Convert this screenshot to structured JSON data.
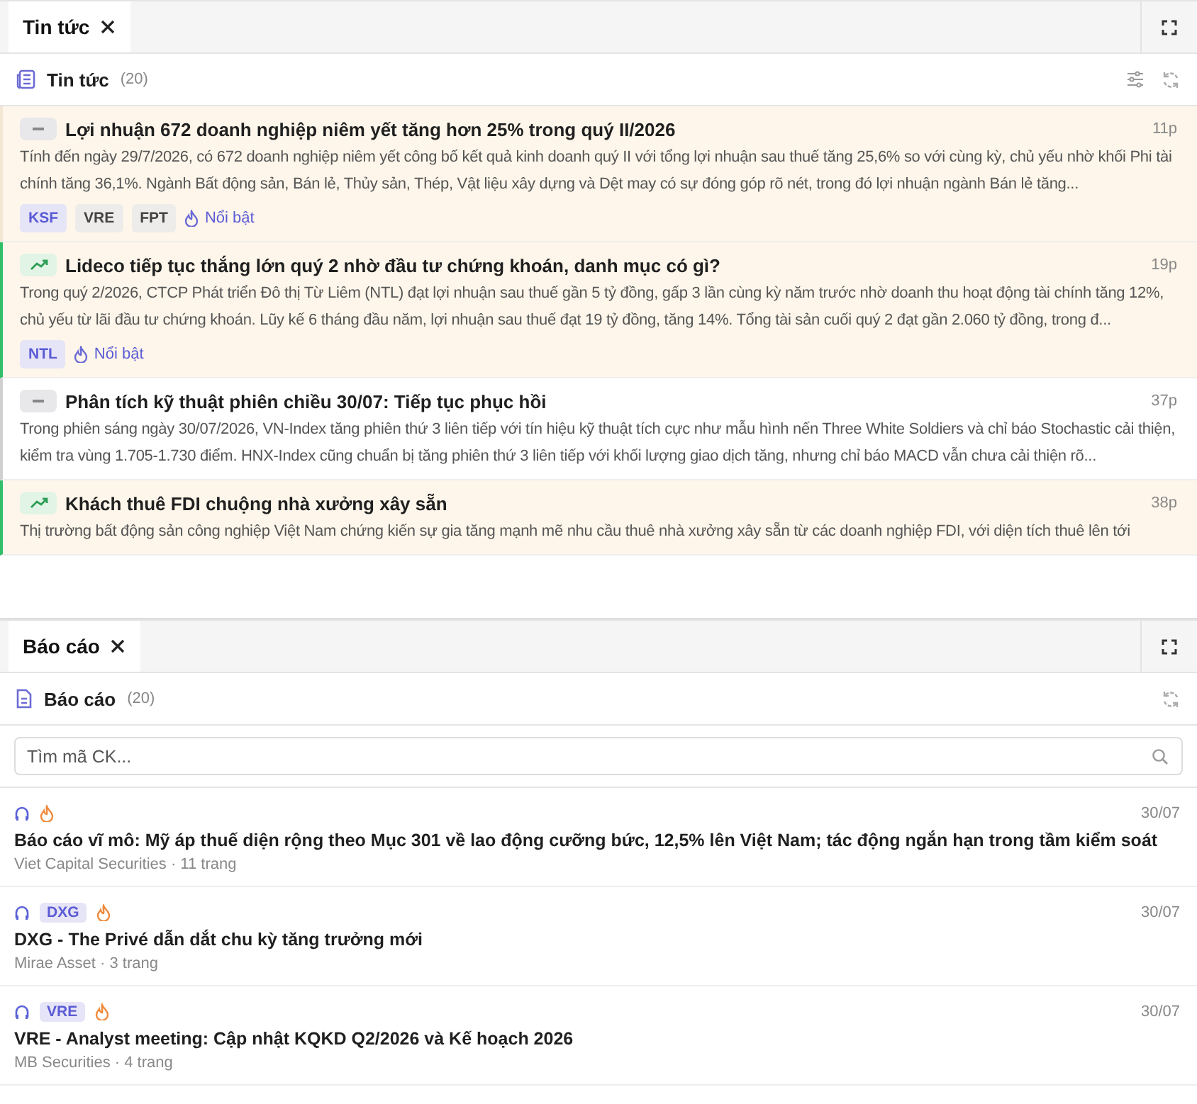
{
  "news_panel": {
    "tab": {
      "label": "Tin tức"
    },
    "header": {
      "title": "Tin tức",
      "count": "(20)"
    },
    "items": [
      {
        "kind": "neutral",
        "highlighted": true,
        "title": "Lợi nhuận 672 doanh nghiệp niêm yết tăng hơn 25% trong quý II/2026",
        "time": "11p",
        "summary": "Tính đến ngày 29/7/2026, có 672 doanh nghiệp niêm yết công bố kết quả kinh doanh quý II với tổng lợi nhuận sau thuế tăng 25,6% so với cùng kỳ, chủ yếu nhờ khối Phi tài chính tăng 36,1%. Ngành Bất động sản, Bán lẻ, Thủy sản, Thép, Vật liệu xây dựng và Dệt may có sự đóng góp rõ nét, trong đó lợi nhuận ngành Bán lẻ tăng...",
        "tags": [
          {
            "label": "KSF",
            "primary": true
          },
          {
            "label": "VRE",
            "primary": false
          },
          {
            "label": "FPT",
            "primary": false
          }
        ],
        "badge": "Nổi bật"
      },
      {
        "kind": "up",
        "highlighted": true,
        "title": "Lideco tiếp tục thắng lớn quý 2 nhờ đầu tư chứng khoán, danh mục có gì?",
        "time": "19p",
        "summary": "Trong quý 2/2026, CTCP Phát triển Đô thị Từ Liêm (NTL) đạt lợi nhuận sau thuế gần 5 tỷ đồng, gấp 3 lần cùng kỳ năm trước nhờ doanh thu hoạt động tài chính tăng 12%, chủ yếu từ lãi đầu tư chứng khoán. Lũy kế 6 tháng đầu năm, lợi nhuận sau thuế đạt 19 tỷ đồng, tăng 14%. Tổng tài sản cuối quý 2 đạt gần 2.060 tỷ đồng, trong đ...",
        "tags": [
          {
            "label": "NTL",
            "primary": true
          }
        ],
        "badge": "Nổi bật"
      },
      {
        "kind": "neutral",
        "highlighted": false,
        "title": "Phân tích kỹ thuật phiên chiều 30/07: Tiếp tục phục hồi",
        "time": "37p",
        "summary": "Trong phiên sáng ngày 30/07/2026, VN-Index tăng phiên thứ 3 liên tiếp với tín hiệu kỹ thuật tích cực như mẫu hình nến Three White Soldiers và chỉ báo Stochastic cải thiện, kiểm tra vùng 1.705-1.730 điểm. HNX-Index cũng chuẩn bị tăng phiên thứ 3 liên tiếp với khối lượng giao dịch tăng, nhưng chỉ báo MACD vẫn chưa cải thiện rõ..."
      },
      {
        "kind": "up",
        "highlighted": true,
        "title": "Khách thuê FDI chuộng nhà xưởng xây sẵn",
        "time": "38p",
        "summary": "Thị trường bất động sản công nghiệp Việt Nam chứng kiến sự gia tăng mạnh mẽ nhu cầu thuê nhà xưởng xây sẵn từ các doanh nghiệp FDI, với diện tích thuê lên tới"
      }
    ]
  },
  "reports_panel": {
    "tab": {
      "label": "Báo cáo"
    },
    "header": {
      "title": "Báo cáo",
      "count": "(20)"
    },
    "search": {
      "placeholder": "Tìm mã CK..."
    },
    "items": [
      {
        "hot": true,
        "date": "30/07",
        "title": "Báo cáo vĩ mô: Mỹ áp thuế diện rộng theo Mục 301 về lao động cưỡng bức, 12,5% lên Việt Nam; tác động ngắn hạn trong tầm kiểm soát",
        "meta": "Viet Capital Securities · 11 trang"
      },
      {
        "ticker": "DXG",
        "hot": true,
        "date": "30/07",
        "title": "DXG - The Privé dẫn dắt chu kỳ tăng trưởng mới",
        "meta": "Mirae Asset · 3 trang"
      },
      {
        "ticker": "VRE",
        "hot": true,
        "date": "30/07",
        "title": "VRE - Analyst meeting: Cập nhật KQKD Q2/2026 và Kế hoạch 2026",
        "meta": "MB Securities · 4 trang"
      }
    ]
  }
}
